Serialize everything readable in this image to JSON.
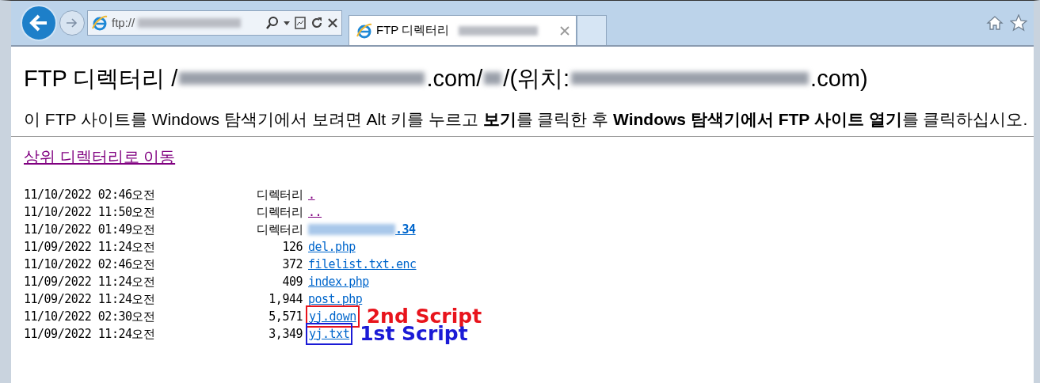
{
  "toolbar": {
    "address": "ftp://",
    "tab_title": "FTP 디렉터리"
  },
  "heading": {
    "prefix": "FTP 디렉터리 /",
    "part_2": ".com/",
    "part_3": "/(위치: ",
    "suffix": ".com)"
  },
  "notice": "이 FTP 사이트를 Windows 탐색기에서 보려면 Alt 키를 누르고 **보기**를 클릭한 후 **Windows 탐색기에서 FTP 사이트 열기**를 클릭하십시오.",
  "parent_link": {
    "label": "상위 디렉터리로 이동",
    "visited": true
  },
  "listing": [
    {
      "date": "11/10/2022 02:46오전",
      "size": "디렉터리",
      "name": ".",
      "visited": true
    },
    {
      "date": "11/10/2022 11:50오전",
      "size": "디렉터리",
      "name": "..",
      "visited": true
    },
    {
      "date": "11/10/2022 01:49오전",
      "size": "디렉터리",
      "name": ".34",
      "visited": false,
      "redacted_prefix": true
    },
    {
      "date": "11/09/2022 11:24오전",
      "size": "126",
      "name": "del.php",
      "visited": false
    },
    {
      "date": "11/10/2022 02:46오전",
      "size": "372",
      "name": "filelist.txt.enc",
      "visited": false
    },
    {
      "date": "11/09/2022 11:24오전",
      "size": "409",
      "name": "index.php",
      "visited": false
    },
    {
      "date": "11/09/2022 11:24오전",
      "size": "1,944",
      "name": "post.php",
      "visited": false
    },
    {
      "date": "11/10/2022 02:30오전",
      "size": "5,571",
      "name": "yj.down",
      "visited": false,
      "annotation": {
        "text": "2nd Script",
        "color": "#e8141c"
      }
    },
    {
      "date": "11/09/2022 11:24오전",
      "size": "3,349",
      "name": "yj.txt",
      "visited": false,
      "annotation": {
        "text": "1st Script",
        "color": "#1b1bd6"
      }
    }
  ]
}
